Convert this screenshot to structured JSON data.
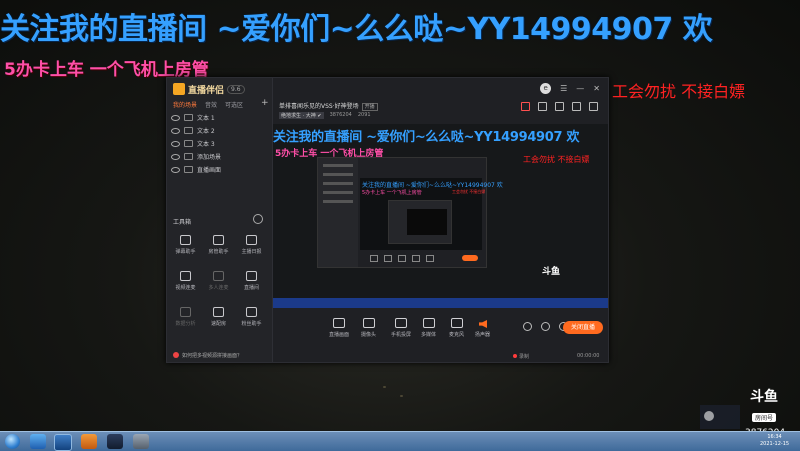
{
  "stream_overlay": {
    "title_line": "关注我的直播间 ~爱你们~么么哒~YY14994907 欢",
    "sub_line": "5办卡上车 一个飞机上房管",
    "notice": "工会勿扰 不接白嫖"
  },
  "app": {
    "logo_text": "直播伴侣",
    "version_badge": "9.6",
    "tabs": [
      "我的场景",
      "音效",
      "可选区"
    ],
    "scenes": [
      "文本 1",
      "文本 2",
      "文本 3",
      "添加场景",
      "直播画面"
    ],
    "tools_title": "工具箱",
    "tools": [
      {
        "label": "弹幕助手",
        "enabled": true
      },
      {
        "label": "房管助手",
        "enabled": true
      },
      {
        "label": "主播日报",
        "enabled": true
      },
      {
        "label": "视频连麦",
        "enabled": true
      },
      {
        "label": "多人连麦",
        "enabled": false
      },
      {
        "label": "直播间",
        "enabled": true
      },
      {
        "label": "数据分析",
        "enabled": false
      },
      {
        "label": "速配房",
        "enabled": true
      },
      {
        "label": "粉丝助手",
        "enabled": true
      }
    ],
    "footer_hint": "如何把多视频源拼接画面？",
    "stream_info": {
      "title": "单排喜闻乐见的VSS·好神登场",
      "tag": "开播",
      "category": "绝地求生 · 大神 ✔",
      "uid_label": "3876204",
      "viewers": "2091"
    },
    "controls": [
      {
        "label": "直播画面"
      },
      {
        "label": "摄像头"
      },
      {
        "label": "手机投屏"
      },
      {
        "label": "多媒体"
      },
      {
        "label": "麦克风"
      },
      {
        "label": "扬声器"
      }
    ],
    "start_button": "关闭直播",
    "status": {
      "bitrate": "录制",
      "timer": "00:00:00"
    }
  },
  "watermark": {
    "platform": "斗鱼",
    "room_label": "房间号",
    "room_number": "3876204"
  },
  "tray": {
    "time": "16:34",
    "date": "2021-12-15"
  },
  "colors": {
    "overlay_blue": "#35a0ff",
    "overlay_pink": "#ff4fa8",
    "notice_red": "#ff2222",
    "accent_orange": "#ff6a1f"
  }
}
